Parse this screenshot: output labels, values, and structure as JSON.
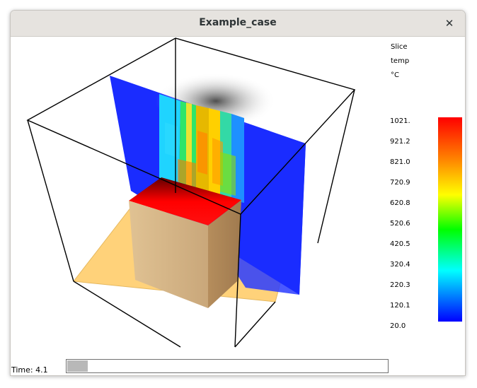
{
  "window": {
    "title": "Example_case"
  },
  "legend": {
    "header": [
      "Slice",
      "temp",
      "°C"
    ],
    "ticks": [
      "1021.",
      "921.2",
      "821.0",
      "720.9",
      "620.8",
      "520.6",
      "420.5",
      "320.4",
      "220.3",
      "120.1",
      "20.0"
    ],
    "colors": [
      "#ff0000",
      "#ff8000",
      "#ffff00",
      "#00ff00",
      "#00ffff",
      "#0000ff"
    ]
  },
  "time": {
    "label": "Time: 4.1",
    "slider_fraction": 0.065
  },
  "scene": {
    "floor_color": "#ffd27a",
    "slice_color": "#2a3cff",
    "box_top_color": "#ff0000",
    "box_side_color": "#d9b98a"
  }
}
